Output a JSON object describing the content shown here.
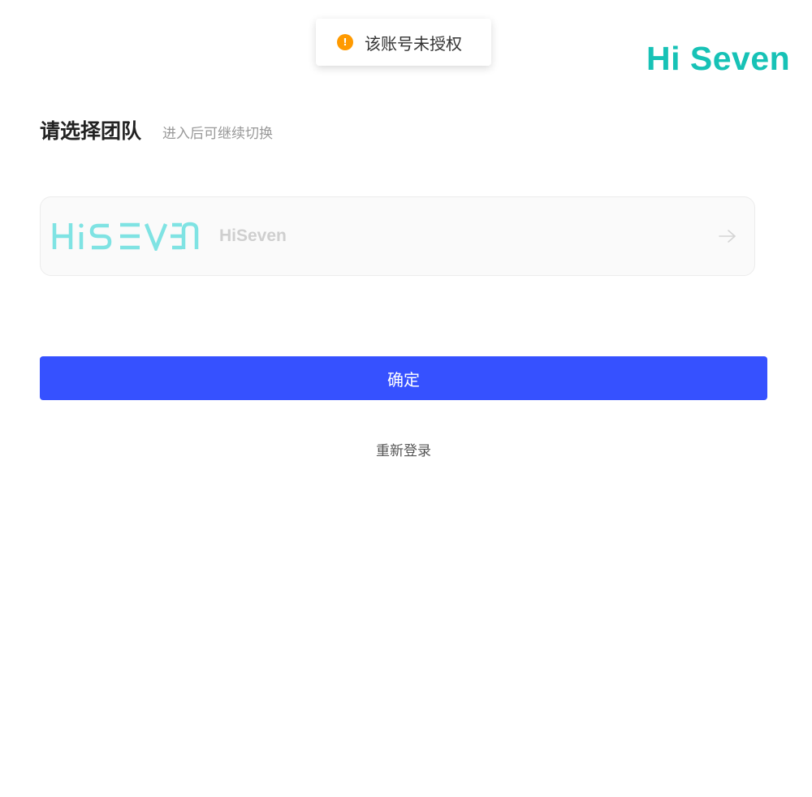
{
  "toast": {
    "icon": "warning-circle-icon",
    "icon_glyph": "!",
    "icon_color": "#ff9a00",
    "message": "该账号未授权"
  },
  "brand": {
    "logo_text": "Hi Seven",
    "color": "#17c2b6"
  },
  "header": {
    "title": "请选择团队",
    "subtitle": "进入后可继续切换"
  },
  "teams": [
    {
      "logo": "hiseven-wordmark-logo",
      "logo_text": "HiSEVEN",
      "logo_color": "#7fe3e3",
      "name": "HiSeven",
      "action_icon": "arrow-right-icon"
    }
  ],
  "actions": {
    "confirm_label": "确定",
    "confirm_color": "#3651ff",
    "relogin_label": "重新登录"
  }
}
